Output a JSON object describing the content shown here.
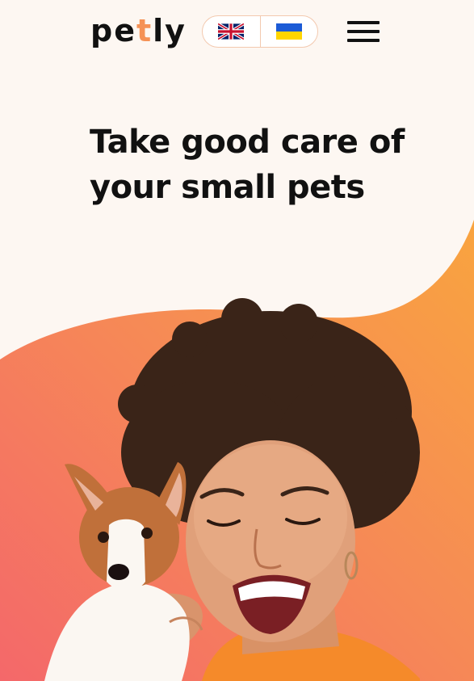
{
  "header": {
    "logo": {
      "part1": "pe",
      "accent": "t",
      "part2": "ly"
    },
    "languages": [
      {
        "code": "en",
        "icon": "uk-flag-icon"
      },
      {
        "code": "uk",
        "icon": "ukraine-flag-icon"
      }
    ],
    "menu_icon": "hamburger-menu-icon"
  },
  "hero": {
    "title_line1": "Take good care of",
    "title_line2": "your small pets",
    "image": "woman-with-puppy-photo"
  },
  "colors": {
    "background": "#FDF7F2",
    "accent": "#F59256",
    "gradient_start": "#F4686A",
    "gradient_end": "#F9A140",
    "text": "#111111"
  }
}
